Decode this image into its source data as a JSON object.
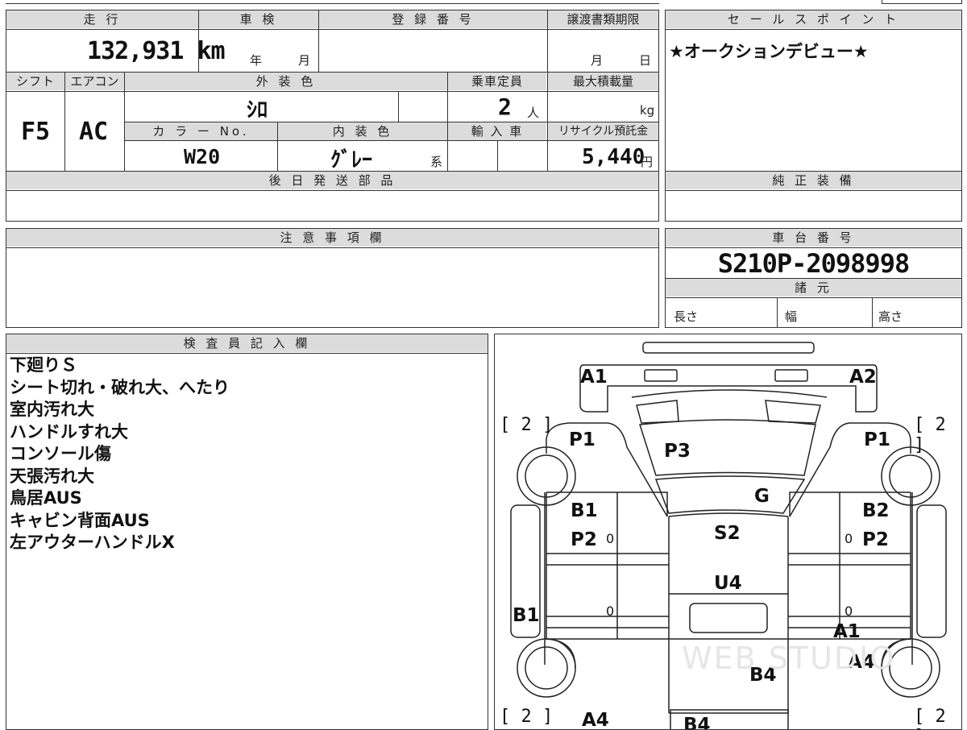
{
  "top": {
    "hdr_mileage": "走 行",
    "hdr_inspection": "車 検",
    "hdr_registration": "登 録 番 号",
    "hdr_transfer": "譲渡書類期限",
    "hdr_sales": "セ ー ル ス ポ イ ン ト",
    "mileage_value": "132,931 km",
    "inspection_year": "年",
    "inspection_month": "月",
    "transfer_month": "月",
    "transfer_day": "日",
    "sales_point": "★オークションデビュー★"
  },
  "spec": {
    "hdr_shift": "シフト",
    "hdr_aircon": "エアコン",
    "hdr_exterior": "外 装 色",
    "hdr_capacity": "乗車定員",
    "hdr_maxload": "最大積載量",
    "shift": "F5",
    "aircon": "AC",
    "exterior": "ｼﾛ",
    "capacity": "2",
    "capacity_unit": "人",
    "load_unit": "kg",
    "hdr_colorno": "カ ラ ー No.",
    "hdr_interior": "内 装 色",
    "hdr_import": "輸 入 車",
    "hdr_recycle": "リサイクル預託金",
    "colorno": "W20",
    "interior": "ｸﾞﾚｰ",
    "interior_suffix": "系",
    "recycle": "5,440",
    "recycle_unit": "円"
  },
  "later_parts": {
    "header": "後 日 発 送 部 品"
  },
  "genuine": {
    "header": "純 正 装 備"
  },
  "notes": {
    "header": "注 意 事 項 欄"
  },
  "chassis": {
    "header": "車 台 番 号",
    "number": "S210P-2098998",
    "specs_header": "諸 元",
    "length": "長さ",
    "width": "幅",
    "height": "高さ"
  },
  "inspector": {
    "header": "検 査 員 記 入 欄",
    "lines": [
      "下廻りＳ",
      "シート切れ・破れ大、へたり",
      "室内汚れ大",
      "ハンドルすれ大",
      "コンソール傷",
      "天張汚れ大",
      "鳥居AUS",
      "キャビン背面AUS",
      "左アウターハンドルX"
    ]
  },
  "diagram": {
    "labels": {
      "a1_top": "A1",
      "a2_top": "A2",
      "p1_left": "P1",
      "p1_right": "P1",
      "p3": "P3",
      "g": "G",
      "b1_left": "B1",
      "b2_right": "B2",
      "p2_left": "P2",
      "p2_right": "P2",
      "s2": "S2",
      "u4": "U4",
      "b1_side": "B1",
      "a1_right": "A1",
      "a4_right": "A4",
      "b4_center": "B4",
      "a4_bottom": "A4",
      "b4_bottom": "B4"
    },
    "tire_marks": [
      "[ 2 ]",
      "[ 2 ]",
      "[ 2 ]",
      "[ 2 ]"
    ],
    "zeros": [
      "0",
      "0",
      "0",
      "0"
    ],
    "watermark": "WEB STUDIO"
  }
}
